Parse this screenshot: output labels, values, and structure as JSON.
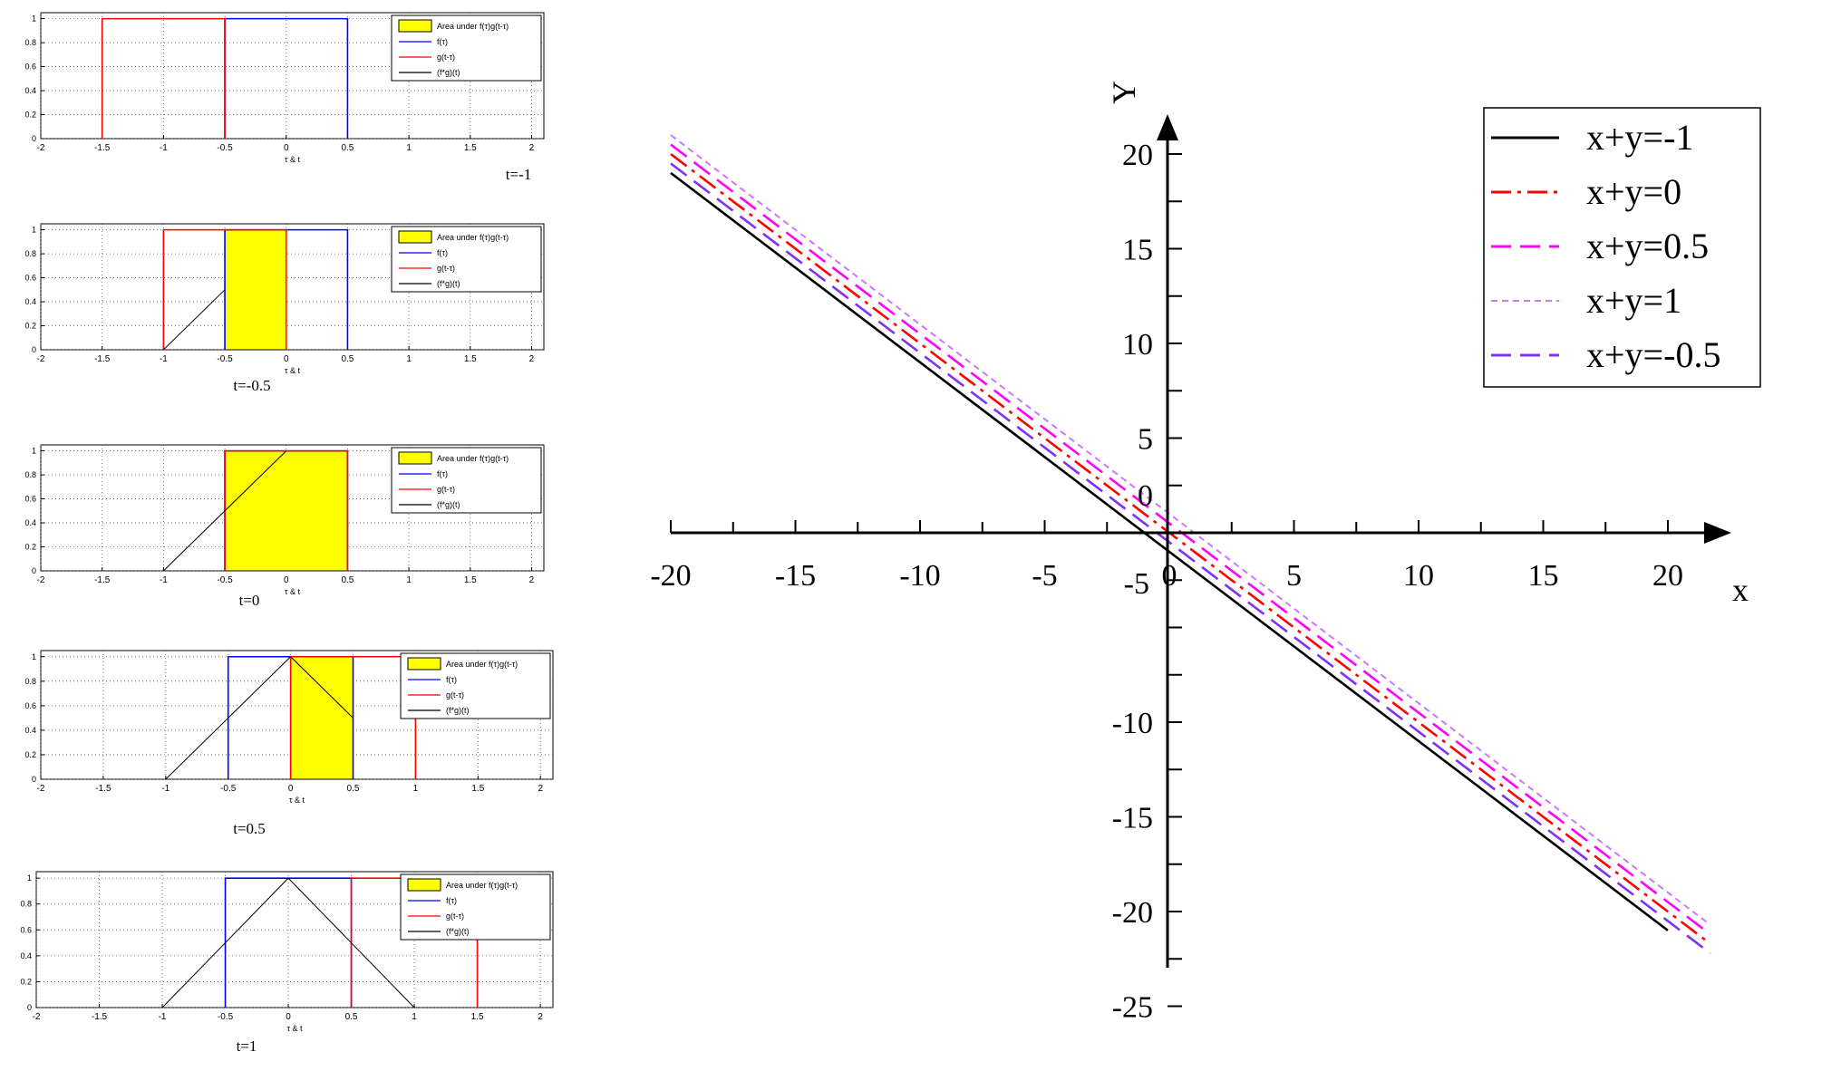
{
  "chart_data": [
    {
      "type": "line",
      "panel_caption": "t=-1",
      "xlabel": "τ & t",
      "xlim": [
        -2,
        2.1
      ],
      "ylim": [
        0,
        1.05
      ],
      "xticks": [
        -2,
        -1.5,
        -1,
        -0.5,
        0,
        0.5,
        1,
        1.5,
        2
      ],
      "xtick_labels": [
        "-2",
        "-1.5",
        "-1",
        "-0.5",
        "0",
        "0.5",
        "1",
        "1.5",
        "2"
      ],
      "yticks": [
        0,
        0.2,
        0.4,
        0.6,
        0.8,
        1
      ],
      "ytick_labels": [
        "0",
        "0.2",
        "0.4",
        "0.6",
        "0.8",
        "1"
      ],
      "grid": true,
      "legend_position": "top-right",
      "area": [],
      "series": [
        {
          "name": "f(τ)",
          "color": "#0000ff",
          "x": [
            -0.5,
            -0.5,
            0.5,
            0.5
          ],
          "y": [
            0,
            1,
            1,
            0
          ]
        },
        {
          "name": "g(t-τ)",
          "color": "#ff0000",
          "x": [
            -1.5,
            -1.5,
            -0.5,
            -0.5
          ],
          "y": [
            0,
            1,
            1,
            0
          ]
        },
        {
          "name": "(f*g)(t)",
          "color": "#000000",
          "x": [],
          "y": []
        }
      ],
      "legend_entries": [
        "Area under f(τ)g(t-τ)",
        "f(τ)",
        "g(t-τ)",
        "(f*g)(t)"
      ]
    },
    {
      "type": "line",
      "panel_caption": "t=-0.5",
      "xlabel": "τ & t",
      "xlim": [
        -2,
        2.1
      ],
      "ylim": [
        0,
        1.05
      ],
      "xticks": [
        -2,
        -1.5,
        -1,
        -0.5,
        0,
        0.5,
        1,
        1.5,
        2
      ],
      "xtick_labels": [
        "-2",
        "-1.5",
        "-1",
        "-0.5",
        "0",
        "0.5",
        "1",
        "1.5",
        "2"
      ],
      "yticks": [
        0,
        0.2,
        0.4,
        0.6,
        0.8,
        1
      ],
      "ytick_labels": [
        "0",
        "0.2",
        "0.4",
        "0.6",
        "0.8",
        "1"
      ],
      "grid": true,
      "legend_position": "top-right",
      "area": [
        -0.5,
        0
      ],
      "series": [
        {
          "name": "f(τ)",
          "color": "#0000ff",
          "x": [
            -0.5,
            -0.5,
            0.5,
            0.5
          ],
          "y": [
            0,
            1,
            1,
            0
          ]
        },
        {
          "name": "g(t-τ)",
          "color": "#ff0000",
          "x": [
            -1,
            -1,
            0,
            0
          ],
          "y": [
            0,
            1,
            1,
            0
          ]
        },
        {
          "name": "(f*g)(t)",
          "color": "#000000",
          "x": [
            -1,
            -0.5
          ],
          "y": [
            0,
            0.5
          ]
        }
      ],
      "legend_entries": [
        "Area under f(τ)g(t-τ)",
        "f(τ)",
        "g(t-τ)",
        "(f*g)(t)"
      ]
    },
    {
      "type": "line",
      "panel_caption": "t=0",
      "xlabel": "τ & t",
      "xlim": [
        -2,
        2.1
      ],
      "ylim": [
        0,
        1.05
      ],
      "xticks": [
        -2,
        -1.5,
        -1,
        -0.5,
        0,
        0.5,
        1,
        1.5,
        2
      ],
      "xtick_labels": [
        "-2",
        "-1.5",
        "-1",
        "-0.5",
        "0",
        "0.5",
        "1",
        "1.5",
        "2"
      ],
      "yticks": [
        0,
        0.2,
        0.4,
        0.6,
        0.8,
        1
      ],
      "ytick_labels": [
        "0",
        "0.2",
        "0.4",
        "0.6",
        "0.8",
        "1"
      ],
      "grid": true,
      "legend_position": "top-right",
      "area": [
        -0.5,
        0.5
      ],
      "series": [
        {
          "name": "f(τ)",
          "color": "#0000ff",
          "x": [
            -0.5,
            -0.5,
            0.5,
            0.5
          ],
          "y": [
            0,
            1,
            1,
            0
          ]
        },
        {
          "name": "g(t-τ)",
          "color": "#ff0000",
          "x": [
            -0.5,
            -0.5,
            0.5,
            0.5
          ],
          "y": [
            0,
            1,
            1,
            0
          ]
        },
        {
          "name": "(f*g)(t)",
          "color": "#000000",
          "x": [
            -1,
            0
          ],
          "y": [
            0,
            1
          ]
        }
      ],
      "legend_entries": [
        "Area under f(τ)g(t-τ)",
        "f(τ)",
        "g(t-τ)",
        "(f*g)(t)"
      ]
    },
    {
      "type": "line",
      "panel_caption": "t=0.5",
      "xlabel": "τ & t",
      "xlim": [
        -2,
        2.1
      ],
      "ylim": [
        0,
        1.05
      ],
      "xticks": [
        -2,
        -1.5,
        -1,
        -0.5,
        0,
        0.5,
        1,
        1.5,
        2
      ],
      "xtick_labels": [
        "-2",
        "-1.5",
        "-1",
        "-0.5",
        "0",
        "0.5",
        "1",
        "1.5",
        "2"
      ],
      "yticks": [
        0,
        0.2,
        0.4,
        0.6,
        0.8,
        1
      ],
      "ytick_labels": [
        "0",
        "0.2",
        "0.4",
        "0.6",
        "0.8",
        "1"
      ],
      "grid": true,
      "legend_position": "top-right",
      "area": [
        0,
        0.5
      ],
      "series": [
        {
          "name": "f(τ)",
          "color": "#0000ff",
          "x": [
            -0.5,
            -0.5,
            0.5,
            0.5
          ],
          "y": [
            0,
            1,
            1,
            0
          ]
        },
        {
          "name": "g(t-τ)",
          "color": "#ff0000",
          "x": [
            0,
            0,
            1,
            1
          ],
          "y": [
            0,
            1,
            1,
            0
          ]
        },
        {
          "name": "(f*g)(t)",
          "color": "#000000",
          "x": [
            -1,
            0,
            0.5
          ],
          "y": [
            0,
            1,
            0.5
          ]
        }
      ],
      "legend_entries": [
        "Area under f(τ)g(t-τ)",
        "f(τ)",
        "g(t-τ)",
        "(f*g)(t)"
      ]
    },
    {
      "type": "line",
      "panel_caption": "t=1",
      "xlabel": "τ & t",
      "xlim": [
        -2,
        2.1
      ],
      "ylim": [
        0,
        1.05
      ],
      "xticks": [
        -2,
        -1.5,
        -1,
        -0.5,
        0,
        0.5,
        1,
        1.5,
        2
      ],
      "xtick_labels": [
        "-2",
        "-1.5",
        "-1",
        "-0.5",
        "0",
        "0.5",
        "1",
        "1.5",
        "2"
      ],
      "yticks": [
        0,
        0.2,
        0.4,
        0.6,
        0.8,
        1
      ],
      "ytick_labels": [
        "0",
        "0.2",
        "0.4",
        "0.6",
        "0.8",
        "1"
      ],
      "grid": true,
      "legend_position": "top-right",
      "area": [],
      "series": [
        {
          "name": "f(τ)",
          "color": "#0000ff",
          "x": [
            -0.5,
            -0.5,
            0.5,
            0.5
          ],
          "y": [
            0,
            1,
            1,
            0
          ]
        },
        {
          "name": "g(t-τ)",
          "color": "#ff0000",
          "x": [
            0.5,
            0.5,
            1.5,
            1.5
          ],
          "y": [
            0,
            1,
            1,
            0
          ]
        },
        {
          "name": "(f*g)(t)",
          "color": "#000000",
          "x": [
            -1,
            0,
            1
          ],
          "y": [
            0,
            1,
            0
          ]
        }
      ],
      "legend_entries": [
        "Area under f(τ)g(t-τ)",
        "f(τ)",
        "g(t-τ)",
        "(f*g)(t)"
      ]
    },
    {
      "type": "line",
      "xlabel": "x",
      "ylabel": "Y",
      "xlim": [
        -20,
        22
      ],
      "ylim": [
        -26,
        22
      ],
      "xticks": [
        -20,
        -15,
        -10,
        -5,
        0,
        5,
        10,
        15,
        20
      ],
      "xtick_labels": [
        "-20",
        "-15",
        "-10",
        "-5",
        "0",
        "5",
        "10",
        "15",
        "20"
      ],
      "yticks": [
        -25,
        -20,
        -15,
        -10,
        -5,
        0,
        5,
        10,
        15,
        20
      ],
      "ytick_labels": [
        "-25",
        "-20",
        "-15",
        "-10",
        "-5",
        "0",
        "5",
        "10",
        "15",
        "20"
      ],
      "grid": false,
      "legend_position": "top-right",
      "series": [
        {
          "name": "x+y=-1",
          "color": "#000000",
          "dash": "solid",
          "x": [
            -20,
            20
          ],
          "y": [
            19,
            -21
          ]
        },
        {
          "name": "x+y=0",
          "color": "#ff0000",
          "dash": "dashdot",
          "x": [
            -20,
            21.5
          ],
          "y": [
            20,
            -21.5
          ]
        },
        {
          "name": "x+y=0.5",
          "color": "#ff00ff",
          "dash": "dash",
          "x": [
            -20,
            21.7
          ],
          "y": [
            20.5,
            -21.2
          ]
        },
        {
          "name": "x+y=1",
          "color": "#cc77ff",
          "dash": "dot",
          "x": [
            -20,
            21.7
          ],
          "y": [
            21,
            -20.7
          ]
        },
        {
          "name": "x+y=-0.5",
          "color": "#7f2fff",
          "dash": "dash",
          "x": [
            -20,
            21.7
          ],
          "y": [
            19.5,
            -22.2
          ]
        }
      ]
    }
  ]
}
